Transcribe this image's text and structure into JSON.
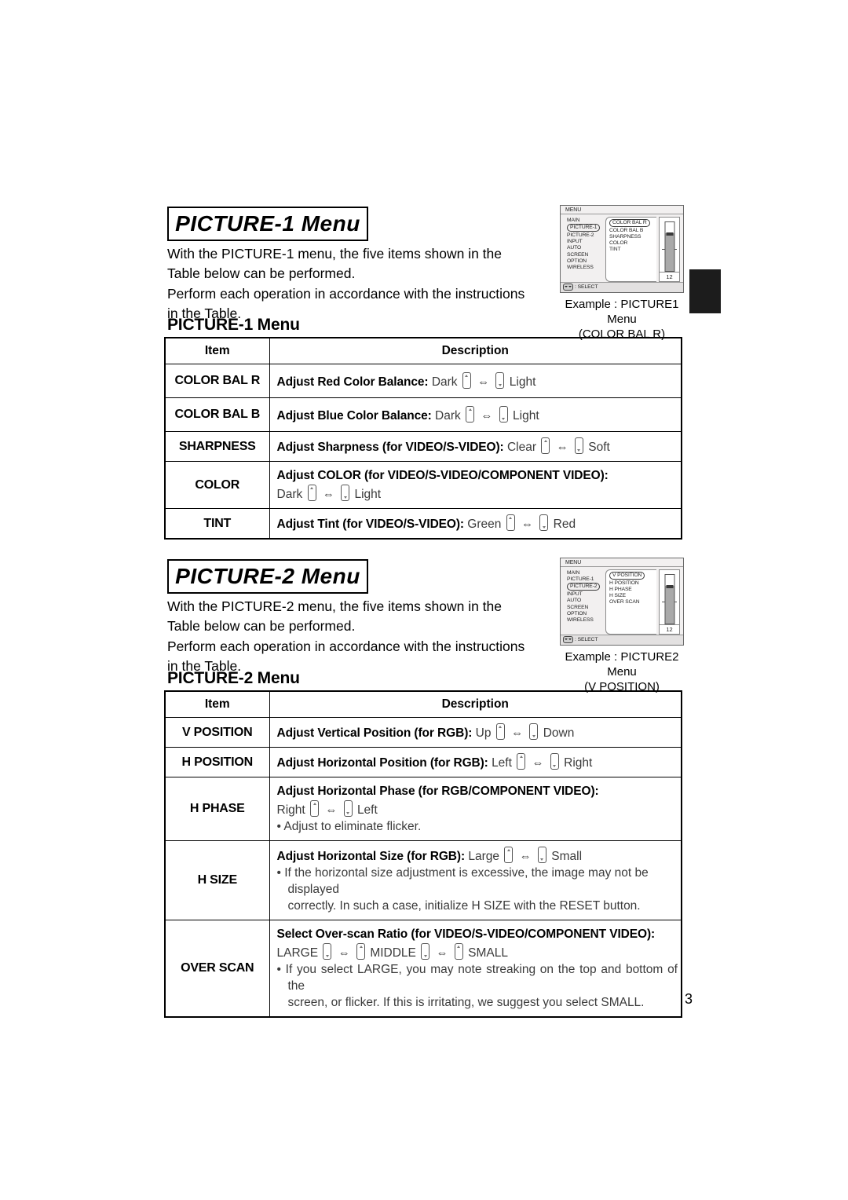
{
  "page": {
    "number": "3"
  },
  "sections": [
    {
      "banner": "PICTURE-1 Menu",
      "intro_line1": "With the PICTURE-1 menu, the five items shown in the Table below can be performed.",
      "intro_line2": "Perform each operation in accordance with the instructions in the Table.",
      "table_heading": "PICTURE-1 Menu",
      "headers": {
        "item": "Item",
        "description": "Description"
      },
      "rows": [
        {
          "item": "COLOR BAL R",
          "bold": "Adjust Red Color Balance:",
          "left": "Dark",
          "right": "Light",
          "keys": [
            "up",
            "down"
          ]
        },
        {
          "item": "COLOR BAL B",
          "bold": "Adjust Blue Color Balance:",
          "left": "Dark",
          "right": "Light",
          "keys": [
            "up",
            "down"
          ]
        },
        {
          "item": "SHARPNESS",
          "bold": "Adjust Sharpness (for VIDEO/S-VIDEO):",
          "left": "Clear",
          "right": "Soft",
          "keys": [
            "up",
            "down"
          ]
        },
        {
          "item": "COLOR",
          "bold": "Adjust COLOR (for VIDEO/S-VIDEO/COMPONENT VIDEO):",
          "left": "Dark",
          "right": "Light",
          "keys": [
            "up",
            "down"
          ],
          "wrap": true
        },
        {
          "item": "TINT",
          "bold": "Adjust Tint (for VIDEO/S-VIDEO):",
          "left": "Green",
          "right": "Red",
          "keys": [
            "up",
            "down"
          ]
        }
      ],
      "osd": {
        "title": "MENU",
        "left_items": [
          "MAIN",
          "PICTURE-1",
          "PICTURE-2",
          "INPUT",
          "AUTO",
          "SCREEN",
          "OPTION",
          "WIRELESS"
        ],
        "left_selected": "PICTURE-1",
        "right_items": [
          "COLOR BAL R",
          "COLOR BAL B",
          "SHARPNESS",
          "COLOR",
          "TINT"
        ],
        "right_selected": "COLOR BAL R",
        "value": "12",
        "footer": ": SELECT",
        "caption_line1": "Example : PICTURE1 Menu",
        "caption_line2": "(COLOR BAL R)"
      }
    },
    {
      "banner": "PICTURE-2 Menu",
      "intro_line1": "With the PICTURE-2 menu, the five items shown in the Table below can be performed.",
      "intro_line2": "Perform each operation in accordance with the instructions in the Table.",
      "table_heading": "PICTURE-2 Menu",
      "headers": {
        "item": "Item",
        "description": "Description"
      },
      "rows": [
        {
          "item": "V POSITION",
          "bold": "Adjust Vertical Position (for RGB):",
          "left": "Up",
          "right": "Down",
          "keys": [
            "up",
            "down"
          ]
        },
        {
          "item": "H POSITION",
          "bold": "Adjust Horizontal Position (for RGB):",
          "left": "Left",
          "right": "Right",
          "keys": [
            "up",
            "down"
          ]
        },
        {
          "item": "H PHASE",
          "bold": "Adjust Horizontal Phase (for RGB/COMPONENT VIDEO):",
          "left": "Right",
          "right": "Left",
          "keys": [
            "up",
            "down"
          ],
          "wrap": true,
          "bullets": [
            "• Adjust to eliminate flicker."
          ]
        },
        {
          "item": "H SIZE",
          "bold": "Adjust Horizontal Size (for RGB):",
          "left": "Large",
          "right": "Small",
          "keys": [
            "up",
            "down"
          ],
          "bullets": [
            "• If the horizontal size adjustment is excessive, the image may not be displayed",
            "correctly. In such a case, initialize H SIZE with the RESET button."
          ]
        },
        {
          "item": "OVER SCAN",
          "bold": "Select Over-scan Ratio (for VIDEO/S-VIDEO/COMPONENT VIDEO):",
          "triple": {
            "a": "LARGE",
            "b": "MIDDLE",
            "c": "SMALL"
          },
          "keys": [
            "down",
            "up",
            "down",
            "up"
          ],
          "bullets": [
            "• If you select LARGE, you may note streaking on the top and bottom of the",
            "screen, or flicker. If this is irritating, we suggest you select SMALL."
          ]
        }
      ],
      "osd": {
        "title": "MENU",
        "left_items": [
          "MAIN",
          "PICTURE-1",
          "PICTURE-2",
          "INPUT",
          "AUTO",
          "SCREEN",
          "OPTION",
          "WIRELESS"
        ],
        "left_selected": "PICTURE-2",
        "right_items": [
          "V POSITION",
          "H POSITION",
          "H PHASE",
          "H SIZE",
          "OVER SCAN"
        ],
        "right_selected": "V POSITION",
        "value": "12",
        "footer": ": SELECT",
        "caption_line1": "Example : PICTURE2 Menu",
        "caption_line2": "(V POSITION)"
      }
    }
  ]
}
